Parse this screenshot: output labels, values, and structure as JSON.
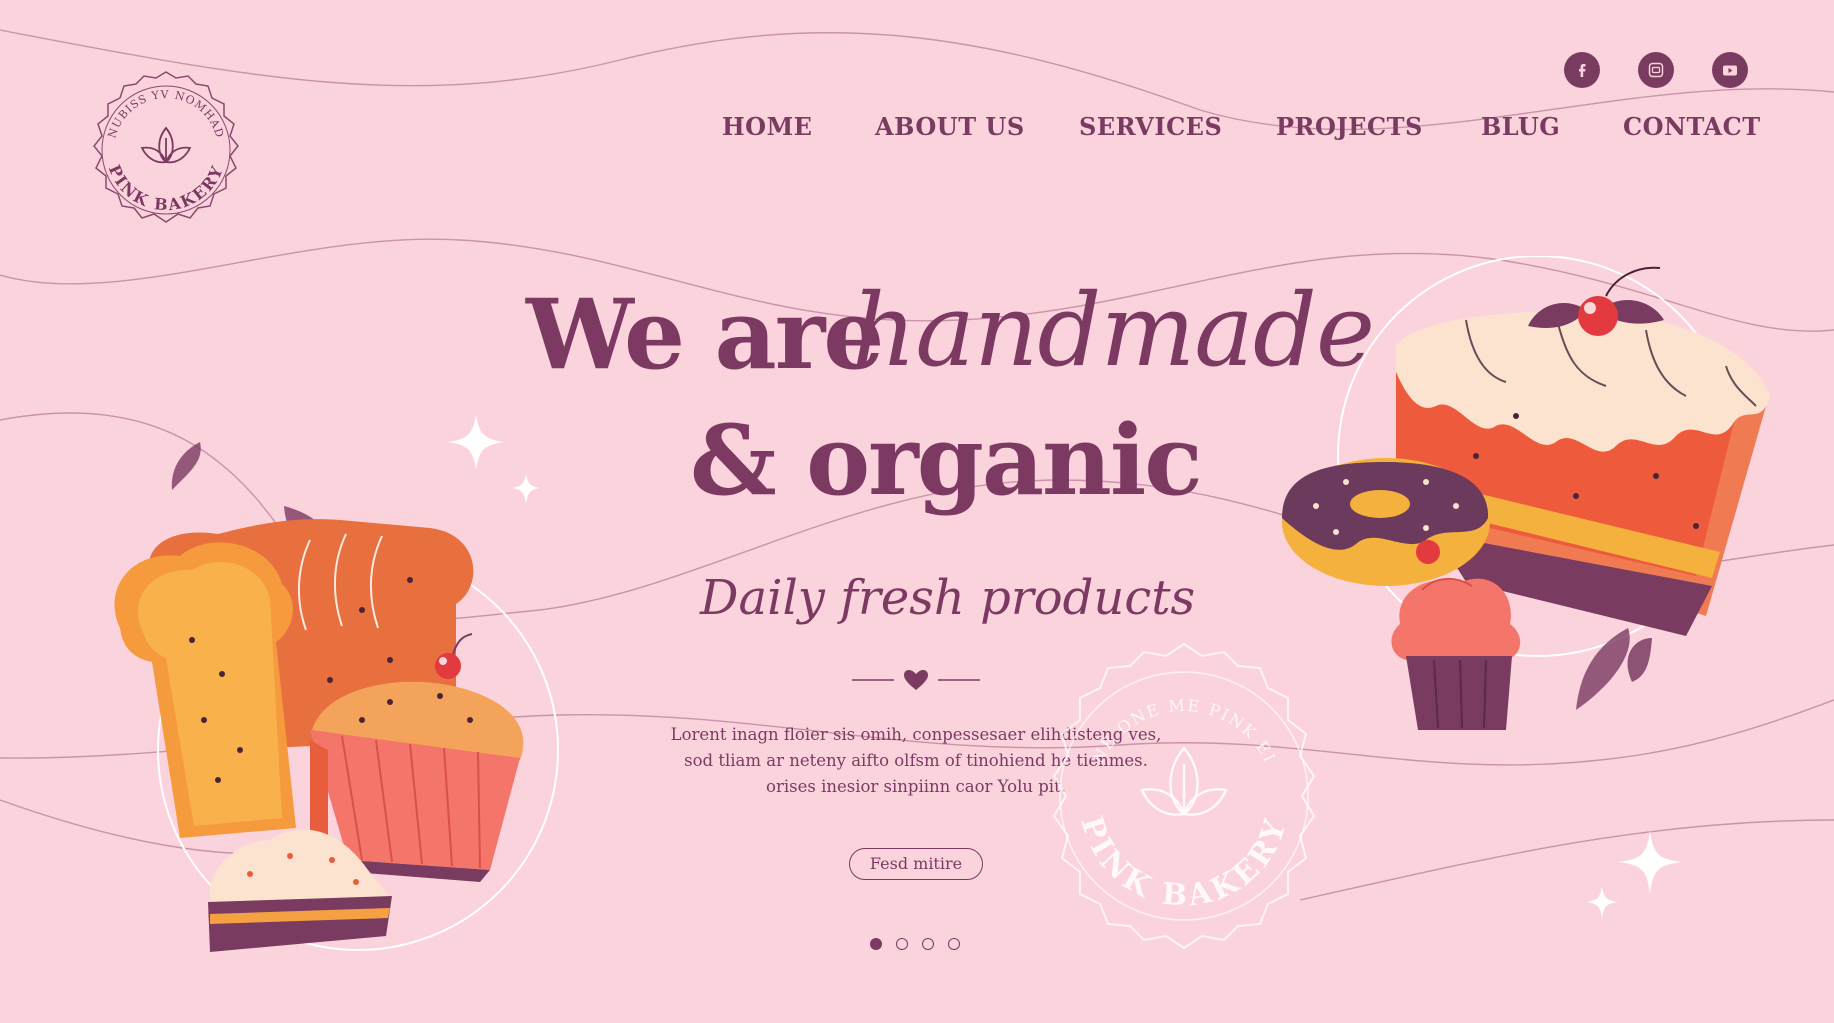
{
  "logo": {
    "arc_top": "NUBISS YV NOMHAD",
    "arc_bottom": "PINK BAKERY"
  },
  "social": [
    {
      "icon": "facebook-icon"
    },
    {
      "icon": "instagram-icon"
    },
    {
      "icon": "youtube-icon"
    }
  ],
  "nav": {
    "items": [
      "HOME",
      "ABOUT US",
      "SERVICES",
      "PROJECTS",
      "BLUG",
      "CONTACT"
    ]
  },
  "hero": {
    "line1_solid": "We are",
    "line1_script": "handmade",
    "line2": "& organic",
    "tagline": "Daily fresh products",
    "body_lines": [
      "Lorent inagn floier sis omih, conpessesaer elihdisteng ves,",
      "sod tliam ar neteny aifto olfsm of tinohiend he tienmes.",
      "orises inesior sinpiinn caor Yolu pit."
    ],
    "cta": "Fesd mitire"
  },
  "stamp": {
    "arc_top": "NE ONE ME PINK EI",
    "arc_bottom": "PINK BAKERY"
  },
  "carousel": {
    "count": 4,
    "active_index": 0
  },
  "colors": {
    "background": "#fbd3dc",
    "primary": "#7c3a63",
    "accent_orange": "#e85d3b",
    "accent_red": "#e33a3f"
  }
}
